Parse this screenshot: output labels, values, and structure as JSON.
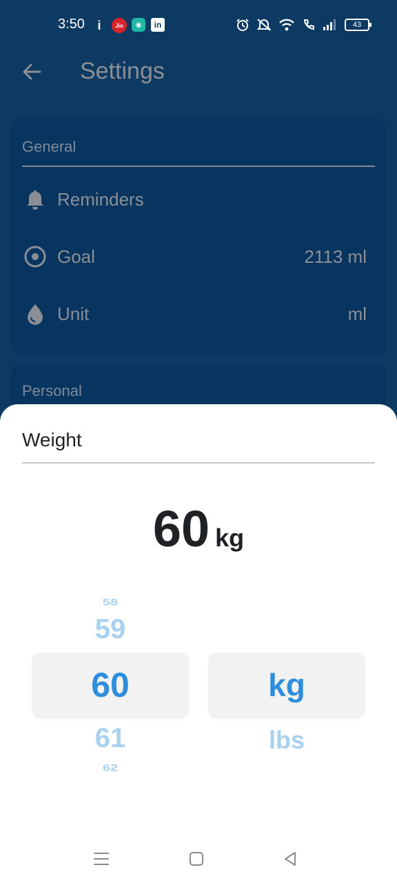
{
  "status_bar": {
    "time": "3:50",
    "jio_label": "Jio",
    "linkedin_label": "in",
    "battery_level": "43"
  },
  "app_bar": {
    "title": "Settings"
  },
  "general": {
    "title": "General",
    "items": [
      {
        "label": "Reminders",
        "value": "",
        "icon": "bell-icon"
      },
      {
        "label": "Goal",
        "value": "2113 ml",
        "icon": "target-icon"
      },
      {
        "label": "Unit",
        "value": "ml",
        "icon": "drop-icon"
      }
    ]
  },
  "personal": {
    "title": "Personal"
  },
  "weight_sheet": {
    "title": "Weight",
    "current_value": "60",
    "current_unit": "kg",
    "number_picker": [
      "58",
      "59",
      "60",
      "61",
      "62"
    ],
    "unit_picker": [
      "kg",
      "lbs"
    ]
  },
  "colors": {
    "background": "#0c3a63",
    "card": "#08355f",
    "accent": "#2f8edb",
    "picker_faded": "#a9d2f0"
  }
}
